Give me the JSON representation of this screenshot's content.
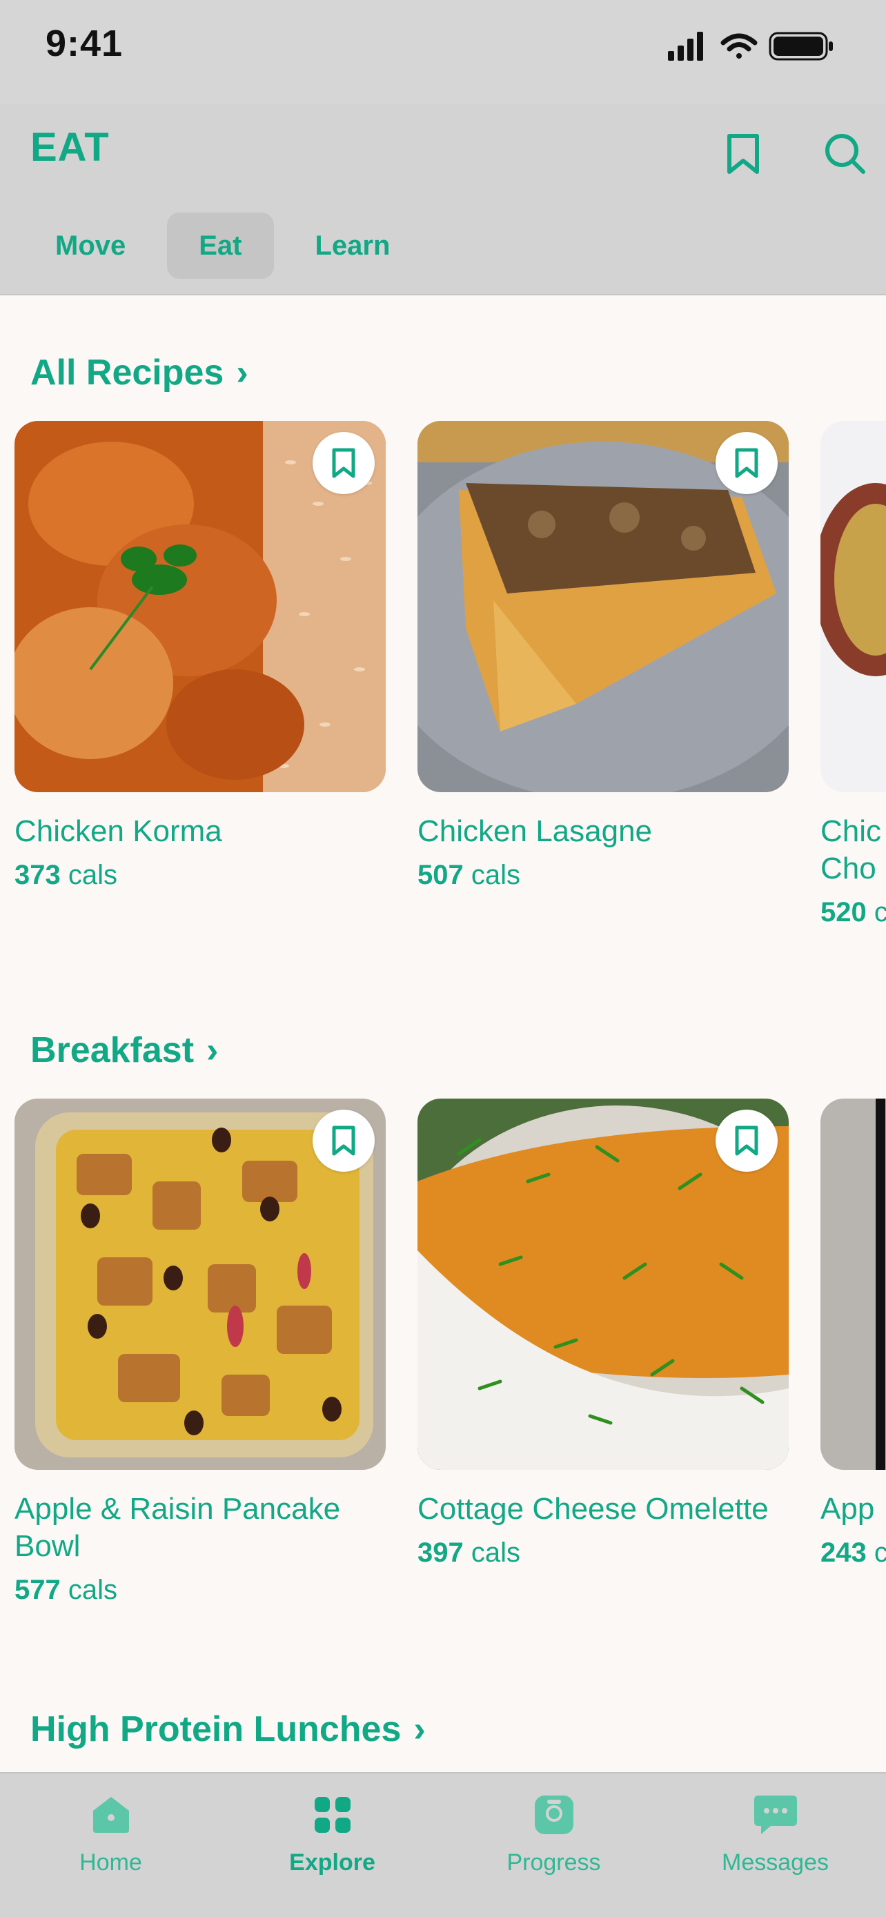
{
  "status_bar": {
    "time": "9:41"
  },
  "header": {
    "title": "EAT",
    "icons": {
      "bookmark": "bookmark-icon",
      "search": "search-icon"
    }
  },
  "tabs": [
    {
      "label": "Move",
      "active": false
    },
    {
      "label": "Eat",
      "active": true
    },
    {
      "label": "Learn",
      "active": false
    }
  ],
  "sections": [
    {
      "title": "All Recipes",
      "cards": [
        {
          "name": "Chicken Korma",
          "cals": "373",
          "unit": "cals"
        },
        {
          "name": "Chicken Lasagne",
          "cals": "507",
          "unit": "cals"
        },
        {
          "name": "Chic\nCho",
          "cals": "520",
          "unit": "c"
        }
      ]
    },
    {
      "title": "Breakfast",
      "cards": [
        {
          "name": "Apple & Raisin Pancake Bowl",
          "cals": "577",
          "unit": "cals"
        },
        {
          "name": "Cottage Cheese Omelette",
          "cals": "397",
          "unit": "cals"
        },
        {
          "name": "App",
          "cals": "243",
          "unit": "c"
        }
      ]
    },
    {
      "title": "High Protein Lunches"
    }
  ],
  "bottom_nav": [
    {
      "label": "Home",
      "icon": "home-icon",
      "active": false
    },
    {
      "label": "Explore",
      "icon": "grid-icon",
      "active": true
    },
    {
      "label": "Progress",
      "icon": "scale-icon",
      "active": false
    },
    {
      "label": "Messages",
      "icon": "chat-icon",
      "active": false
    }
  ],
  "colors": {
    "accent": "#11a886",
    "header_bg": "#d3d3d3",
    "page_bg": "#fcf8f6"
  }
}
